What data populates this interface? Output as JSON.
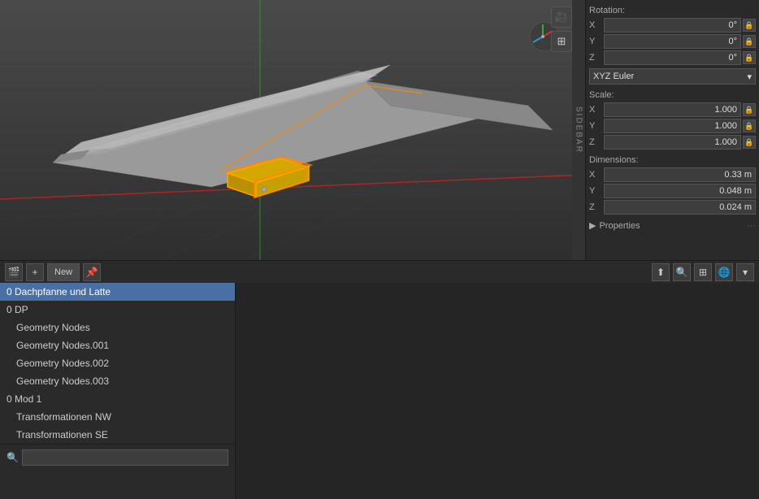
{
  "viewport": {
    "background_color": "#3d3d3d"
  },
  "right_panel": {
    "rotation": {
      "label": "Rotation:",
      "x_label": "X",
      "x_value": "0°",
      "y_label": "Y",
      "y_value": "0°",
      "z_label": "Z",
      "z_value": "0°"
    },
    "rotation_mode": {
      "value": "XYZ Euler",
      "chevron": "▾"
    },
    "scale": {
      "label": "Scale:",
      "x_label": "X",
      "x_value": "1.000",
      "y_label": "Y",
      "y_value": "1.000",
      "z_label": "Z",
      "z_value": "1.000"
    },
    "dimensions": {
      "label": "Dimensions:",
      "x_label": "X",
      "x_value": "0.33 m",
      "y_label": "Y",
      "y_value": "0.048 m",
      "z_label": "Z",
      "z_value": "0.024 m"
    },
    "properties": {
      "label": "Properties",
      "dots": "···"
    }
  },
  "bottom_toolbar": {
    "scene_icon": "🎬",
    "add_icon": "+",
    "new_label": "New",
    "pin_icon": "📌",
    "upload_icon": "⬆",
    "search_icon": "🔍",
    "grid_icon": "⊞",
    "globe_icon": "🌐",
    "chevron_icon": "▾"
  },
  "list": {
    "items": [
      {
        "label": "0 Dachpfanne und Latte",
        "indented": false,
        "selected": true
      },
      {
        "label": "0 DP",
        "indented": false,
        "selected": false
      },
      {
        "label": "Geometry Nodes",
        "indented": true,
        "selected": false
      },
      {
        "label": "Geometry Nodes.001",
        "indented": true,
        "selected": false
      },
      {
        "label": "Geometry Nodes.002",
        "indented": true,
        "selected": false
      },
      {
        "label": "Geometry Nodes.003",
        "indented": true,
        "selected": false
      },
      {
        "label": "0 Mod 1",
        "indented": false,
        "selected": false
      },
      {
        "label": "Transformationen NW",
        "indented": true,
        "selected": false
      },
      {
        "label": "Transformationen SE",
        "indented": true,
        "selected": false
      }
    ]
  },
  "search": {
    "placeholder": "",
    "icon": "🔍"
  },
  "sidebar": {
    "label": "SIDEBAR"
  },
  "viewport_icons": [
    {
      "name": "camera-icon",
      "symbol": "🎥"
    },
    {
      "name": "grid-view-icon",
      "symbol": "⊞"
    }
  ]
}
